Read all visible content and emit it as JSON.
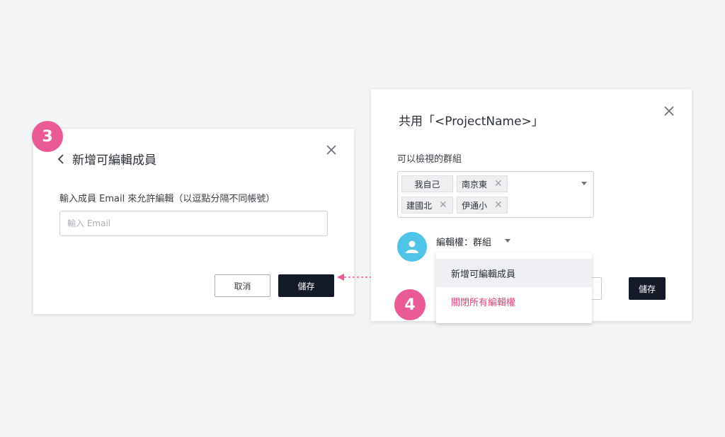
{
  "left_dialog": {
    "title": "新增可編輯成員",
    "email_label": "輸入成員 Email 來允許編輯（以逗點分隔不同帳號）",
    "email_placeholder": "輸入 Email",
    "cancel_label": "取消",
    "save_label": "儲存"
  },
  "step_badges": {
    "step3": "3",
    "step4": "4"
  },
  "right_dialog": {
    "title": "共用「<ProjectName>」",
    "view_groups_label": "可以檢視的群組",
    "tags": [
      {
        "label": "我自己",
        "removable": false
      },
      {
        "label": "南京東",
        "removable": true
      },
      {
        "label": "建國北",
        "removable": true
      },
      {
        "label": "伊通小",
        "removable": true
      }
    ],
    "remove_glyph": "✕",
    "edit_permission_label": "編輯權：群組",
    "save_label": "儲存",
    "menu": {
      "items": [
        {
          "label": "新增可編輯成員",
          "color": "#2b2f36"
        },
        {
          "label": "關閉所有編輯權",
          "color": "#e0457e"
        }
      ]
    }
  },
  "colors": {
    "accent_pink": "#ea5a97",
    "primary_button": "#151a28",
    "avatar": "#4fc4e7",
    "danger_text": "#e0457e"
  },
  "icons": [
    "chevron-left-icon",
    "close-icon",
    "close-icon",
    "tag-remove-icon",
    "chevron-down-icon",
    "user-icon",
    "dotted-arrow-icon"
  ]
}
